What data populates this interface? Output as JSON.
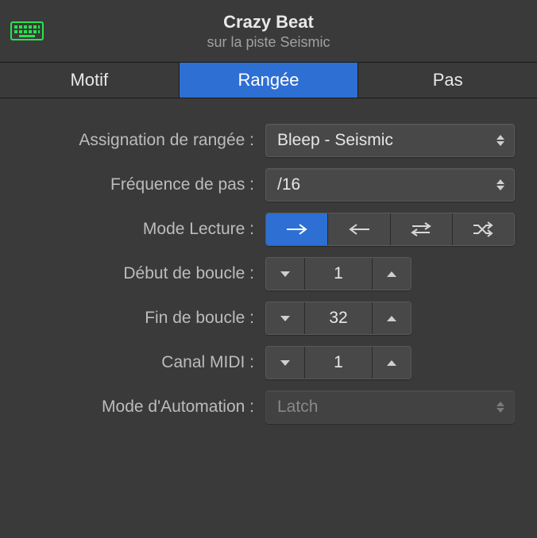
{
  "header": {
    "title": "Crazy Beat",
    "subtitle": "sur la piste Seismic"
  },
  "tabs": {
    "motif": "Motif",
    "rangee": "Rangée",
    "pas": "Pas",
    "active": "rangee"
  },
  "rows": {
    "assignation": {
      "label": "Assignation de rangée :",
      "value": "Bleep - Seismic"
    },
    "frequence": {
      "label": "Fréquence de pas :",
      "value": "/16"
    },
    "playback": {
      "label": "Mode Lecture :",
      "modes": [
        "forward",
        "backward",
        "pingpong",
        "random"
      ],
      "active": "forward"
    },
    "loopstart": {
      "label": "Début de boucle :",
      "value": "1"
    },
    "loopend": {
      "label": "Fin de boucle :",
      "value": "32"
    },
    "midich": {
      "label": "Canal MIDI :",
      "value": "1"
    },
    "automation": {
      "label": "Mode d'Automation :",
      "value": "Latch"
    }
  },
  "colors": {
    "accent": "#2e6fd4",
    "icon": "#28e24c"
  }
}
